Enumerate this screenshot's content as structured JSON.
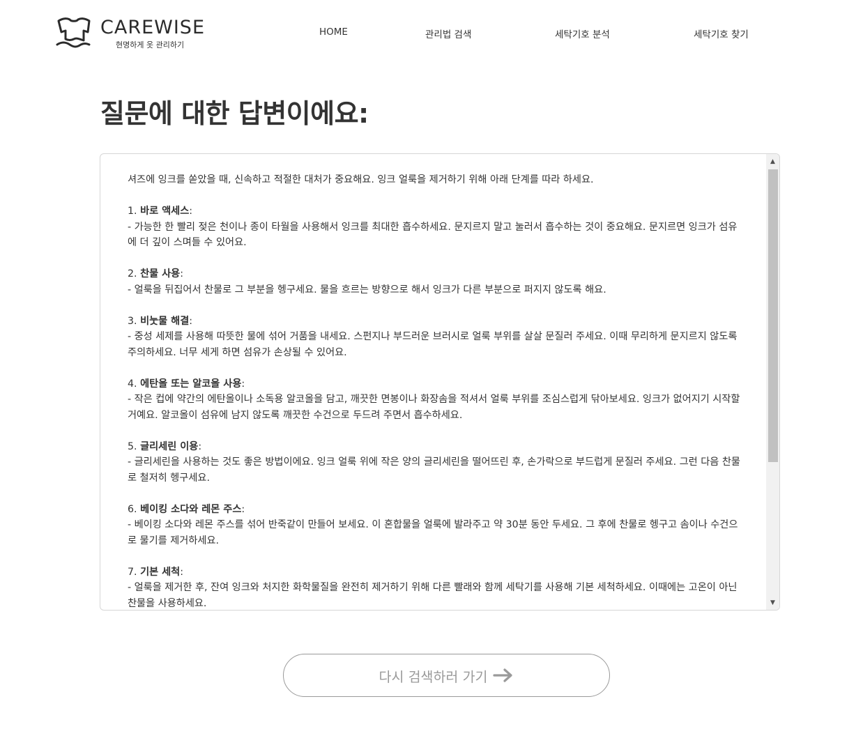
{
  "header": {
    "brand": "CAREWISE",
    "tagline": "현명하게 옷 관리하기",
    "nav": [
      "HOME",
      "관리법 검색",
      "세탁기호 분석",
      "세탁기호 찾기"
    ]
  },
  "page_title": "질문에 대한 답변이에요:",
  "answer": {
    "intro": "셔즈에 잉크를 쏟았을 때, 신속하고 적절한 대처가 중요해요. 잉크 얼룩을 제거하기 위해 아래 단계를 따라 하세요.",
    "steps": [
      {
        "num": "1.",
        "title": "바로 액세스",
        "body": "- 가능한 한 빨리 젖은 천이나 종이 타월을 사용해서 잉크를 최대한 흡수하세요. 문지르지 말고 눌러서 흡수하는 것이 중요해요. 문지르면 잉크가 섬유에 더 깊이 스며들 수 있어요."
      },
      {
        "num": "2.",
        "title": "찬물 사용",
        "body": "- 얼룩을 뒤집어서 찬물로 그 부분을 헹구세요. 물을 흐르는 방향으로 해서 잉크가 다른 부분으로 퍼지지 않도록 해요."
      },
      {
        "num": "3.",
        "title": "비눗물 해결",
        "body": "- 중성 세제를 사용해 따뜻한 물에 섞어 거품을 내세요. 스펀지나 부드러운 브러시로 얼룩 부위를 살살 문질러 주세요. 이때 무리하게 문지르지 않도록 주의하세요. 너무 세게 하면 섬유가 손상될 수 있어요."
      },
      {
        "num": "4.",
        "title": "에탄올 또는 알코올 사용",
        "body": "- 작은 컵에 약간의 에탄올이나 소독용 알코올을 담고, 깨끗한 면봉이나 화장솜을 적셔서 얼룩 부위를 조심스럽게 닦아보세요. 잉크가 없어지기 시작할 거예요. 알코올이 섬유에 남지 않도록 깨끗한 수건으로 두드려 주면서 흡수하세요."
      },
      {
        "num": "5.",
        "title": "글리세린 이용",
        "body": "- 글리세린을 사용하는 것도 좋은 방법이에요. 잉크 얼룩 위에 작은 양의 글리세린을 떨어뜨린 후, 손가락으로 부드럽게 문질러 주세요. 그런 다음 찬물로 철저히 헹구세요."
      },
      {
        "num": "6.",
        "title": "베이킹 소다와 레몬 주스",
        "body": "- 베이킹 소다와 레몬 주스를 섞어 반죽같이 만들어 보세요. 이 혼합물을 얼룩에 발라주고 약 30분 동안 두세요. 그 후에 찬물로 헹구고 솜이나 수건으로 물기를 제거하세요."
      },
      {
        "num": "7.",
        "title": "기본 세척",
        "body": "- 얼룩을 제거한 후, 잔여 잉크와 처지한 화학물질을 완전히 제거하기 위해 다른 빨래와 함께 세탁기를 사용해 기본 세척하세요. 이때에는 고온이 아닌 찬물을 사용하세요."
      }
    ]
  },
  "retry_button": "다시 검색하러 가기",
  "icons": {
    "logo": "shirt-logo-icon",
    "arrow": "arrow-right-icon",
    "scroll_up": "scroll-up-icon",
    "scroll_down": "scroll-down-icon"
  },
  "colors": {
    "text": "#333333",
    "button_text": "#9a9a9a",
    "border": "#d6d6d6"
  }
}
